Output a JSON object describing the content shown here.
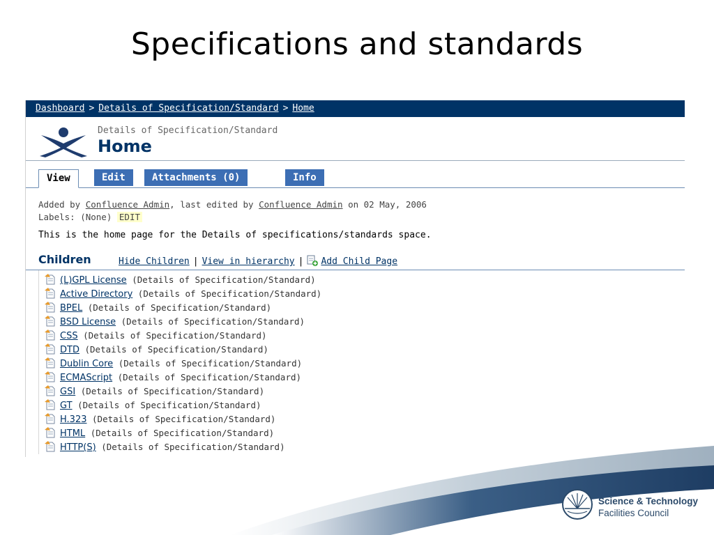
{
  "slide": {
    "title": "Specifications and standards"
  },
  "breadcrumb": {
    "items": [
      "Dashboard",
      "Details of Specification/Standard",
      "Home"
    ],
    "separator": ">"
  },
  "header": {
    "space_name": "Details of Specification/Standard",
    "page_title": "Home",
    "logo_icon": "confluence-logo-icon"
  },
  "tabs": [
    {
      "label": "View",
      "active": true
    },
    {
      "label": "Edit",
      "active": false
    },
    {
      "label": "Attachments (0)",
      "active": false
    },
    {
      "label": "Info",
      "active": false
    }
  ],
  "meta": {
    "added_by_prefix": "Added by",
    "added_by_user": "Confluence Admin",
    "last_edited_prefix": ", last edited by",
    "last_edited_user": "Confluence Admin",
    "date_text": "on 02 May, 2006",
    "labels_prefix": "Labels: (None)",
    "labels_edit": "EDIT"
  },
  "description": "This is the home page for the Details of specifications/standards space.",
  "children": {
    "title": "Children",
    "hide_link": "Hide Children",
    "hierarchy_link": "View in hierarchy",
    "add_link": "Add Child Page",
    "items": [
      {
        "name": "(L)GPL License",
        "space": "(Details of Specification/Standard)"
      },
      {
        "name": "Active Directory",
        "space": "(Details of Specification/Standard)"
      },
      {
        "name": "BPEL",
        "space": "(Details of Specification/Standard)"
      },
      {
        "name": "BSD License",
        "space": "(Details of Specification/Standard)"
      },
      {
        "name": "CSS",
        "space": "(Details of Specification/Standard)"
      },
      {
        "name": "DTD",
        "space": "(Details of Specification/Standard)"
      },
      {
        "name": "Dublin Core",
        "space": "(Details of Specification/Standard)"
      },
      {
        "name": "ECMAScript",
        "space": "(Details of Specification/Standard)"
      },
      {
        "name": "GSI",
        "space": "(Details of Specification/Standard)"
      },
      {
        "name": "GT",
        "space": "(Details of Specification/Standard)"
      },
      {
        "name": "H.323",
        "space": "(Details of Specification/Standard)"
      },
      {
        "name": "HTML",
        "space": "(Details of Specification/Standard)"
      },
      {
        "name": "HTTP(S)",
        "space": "(Details of Specification/Standard)"
      }
    ]
  },
  "footer": {
    "org_line1": "Science & Technology",
    "org_line2": "Facilities Council"
  },
  "colors": {
    "navy": "#003366",
    "tab_blue": "#3c6eb4",
    "label_highlight": "#ffffcc"
  }
}
